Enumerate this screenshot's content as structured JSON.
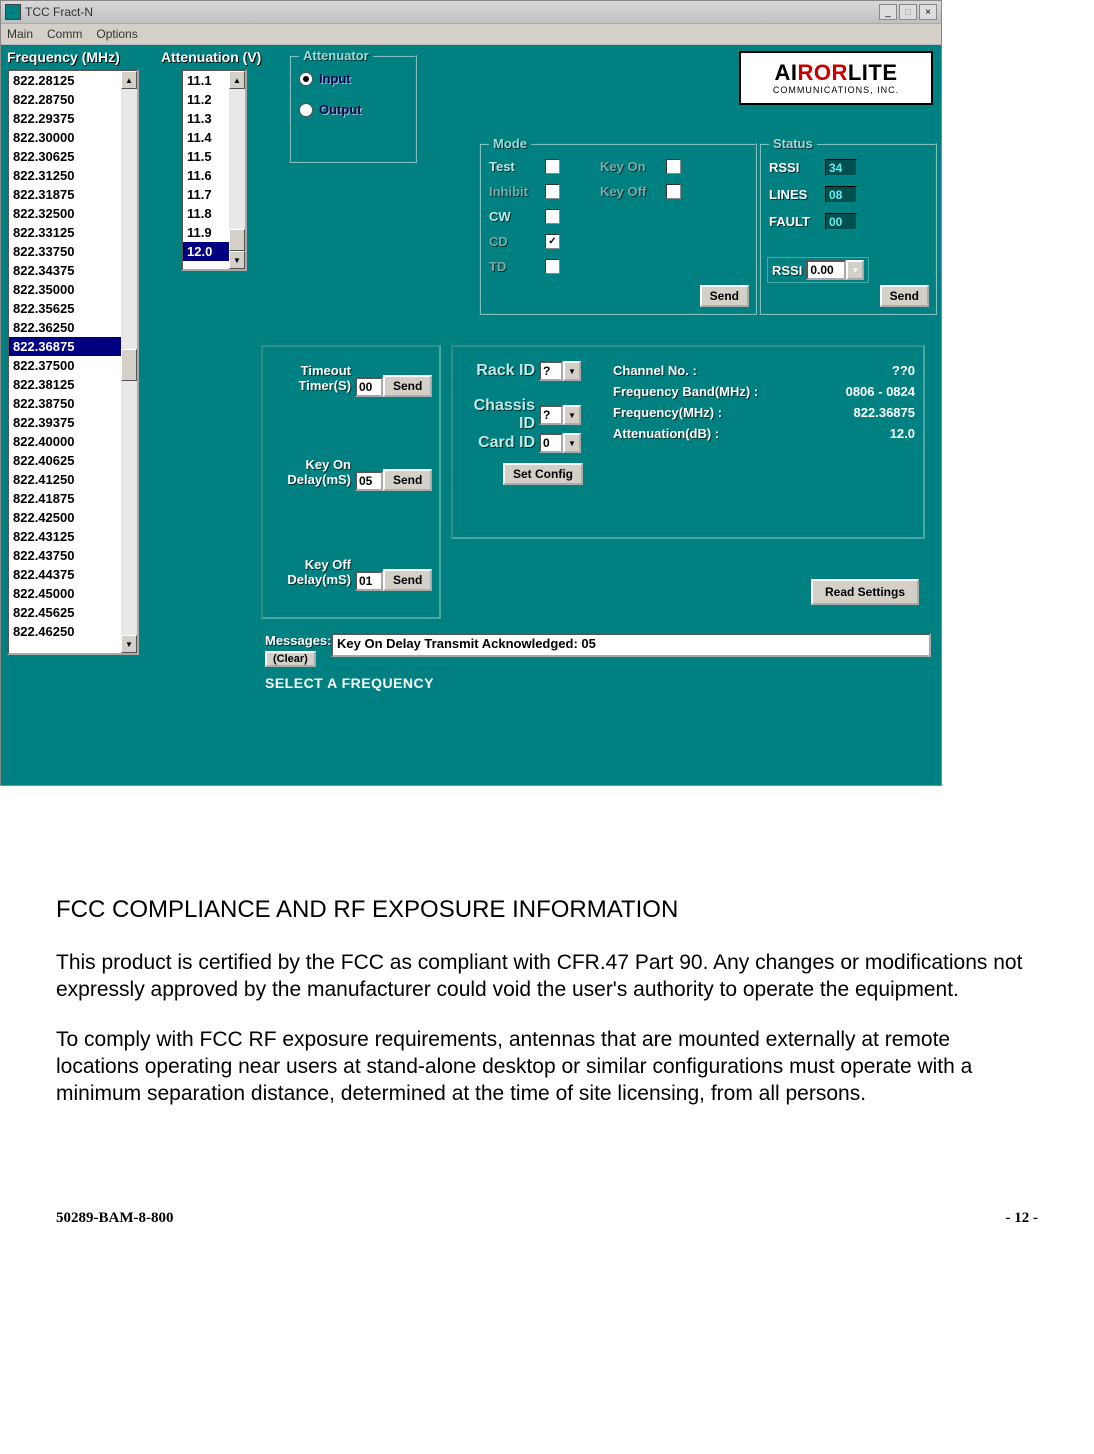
{
  "window": {
    "title": "TCC Fract-N"
  },
  "menubar": [
    "Main",
    "Comm",
    "Options"
  ],
  "freq_label": "Frequency (MHz)",
  "freq_list": [
    "822.28125",
    "822.28750",
    "822.29375",
    "822.30000",
    "822.30625",
    "822.31250",
    "822.31875",
    "822.32500",
    "822.33125",
    "822.33750",
    "822.34375",
    "822.35000",
    "822.35625",
    "822.36250",
    "822.36875",
    "822.37500",
    "822.38125",
    "822.38750",
    "822.39375",
    "822.40000",
    "822.40625",
    "822.41250",
    "822.41875",
    "822.42500",
    "822.43125",
    "822.43750",
    "822.44375",
    "822.45000",
    "822.45625",
    "822.46250"
  ],
  "freq_selected_index": 14,
  "atten_label": "Attenuation (V)",
  "atten_list": [
    "11.1",
    "11.2",
    "11.3",
    "11.4",
    "11.5",
    "11.6",
    "11.7",
    "11.8",
    "11.9",
    "12.0"
  ],
  "atten_selected_index": 9,
  "attenuator_box": {
    "legend": "Attenuator",
    "opt_input": "Input",
    "opt_output": "Output",
    "selected": "input"
  },
  "mode_box": {
    "legend": "Mode",
    "test": "Test",
    "inhibit": "Inhibit",
    "cw": "CW",
    "cd": "CD",
    "td": "TD",
    "keyon": "Key On",
    "keyoff": "Key Off",
    "send": "Send",
    "cd_checked": true
  },
  "status_box": {
    "legend": "Status",
    "rssi": "RSSI",
    "rssi_val": "34",
    "lines": "LINES",
    "lines_val": "08",
    "fault": "FAULT",
    "fault_val": "00",
    "rssi2": "RSSI",
    "rssi2_val": "0.00",
    "send": "Send"
  },
  "timeout": {
    "label1": "Timeout",
    "label2": "Timer(S)",
    "val": "00",
    "send": "Send"
  },
  "keyon": {
    "label1": "Key On",
    "label2": "Delay(mS)",
    "val": "05",
    "send": "Send"
  },
  "keyoff": {
    "label1": "Key Off",
    "label2": "Delay(mS)",
    "val": "01",
    "send": "Send"
  },
  "config": {
    "rack": "Rack ID",
    "rack_val": "?",
    "chassis": "Chassis ID",
    "chassis_val": "?",
    "card": "Card ID",
    "card_val": "0",
    "set": "Set Config"
  },
  "info": {
    "channel_lbl": "Channel No. :",
    "channel_val": "??0",
    "band_lbl": "Frequency Band(MHz) :",
    "band_val": "0806 - 0824",
    "freq_lbl": "Frequency(MHz) :",
    "freq_val": "822.36875",
    "atten_lbl": "Attenuation(dB) :",
    "atten_val": "12.0"
  },
  "read_settings": "Read Settings",
  "messages": {
    "label": "Messages:",
    "clear": "(Clear)",
    "text": "Key On Delay Transmit Acknowledged: 05",
    "below": "SELECT A FREQUENCY"
  },
  "logo": {
    "ai": "AI",
    "ror": "ROR",
    "lite": "LITE",
    "sub": "COMMUNICATIONS, INC."
  },
  "doc": {
    "heading": "FCC COMPLIANCE AND RF EXPOSURE INFORMATION",
    "p1": "This product is certified by the FCC as compliant with CFR.47 Part 90.  Any changes or modifications not expressly approved by the manufacturer could void the user's authority to operate the equipment.",
    "p2": "To comply with FCC RF exposure requirements, antennas that are mounted externally at remote locations operating near users at stand-alone desktop or similar configurations must operate with a minimum separation distance, determined at the time of site licensing, from all persons.",
    "footer_left": "50289-BAM-8-800",
    "footer_right": "- 12 -"
  }
}
